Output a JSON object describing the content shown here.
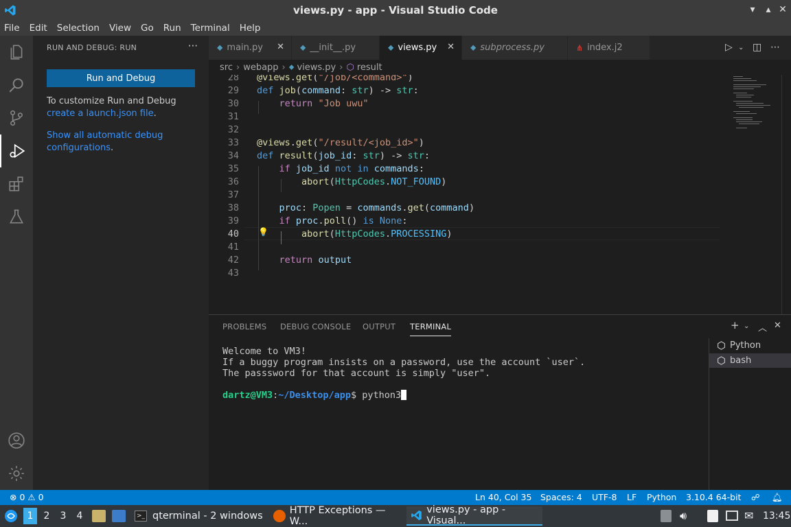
{
  "window": {
    "title": "views.py - app - Visual Studio Code"
  },
  "menu": [
    "File",
    "Edit",
    "Selection",
    "View",
    "Go",
    "Run",
    "Terminal",
    "Help"
  ],
  "sidebar": {
    "header": "RUN AND DEBUG: RUN",
    "run_button": "Run and Debug",
    "info_text": "To customize Run and Debug",
    "link_launch": "create a launch.json file",
    "link_launch_suffix": ".",
    "link_show_1": "Show all automatic debug",
    "link_show_2": "configurations",
    "link_show_suffix": "."
  },
  "tabs": [
    {
      "label": "main.py",
      "active": false,
      "italic": false
    },
    {
      "label": "__init__.py",
      "active": false,
      "italic": false
    },
    {
      "label": "views.py",
      "active": true,
      "italic": false
    },
    {
      "label": "subprocess.py",
      "active": false,
      "italic": true
    },
    {
      "label": "index.j2",
      "active": false,
      "italic": false
    }
  ],
  "breadcrumb": {
    "part1": "src",
    "part2": "webapp",
    "part3": "views.py",
    "part4": "result"
  },
  "editor": {
    "line_numbers": [
      "28",
      "29",
      "30",
      "31",
      "32",
      "33",
      "34",
      "35",
      "36",
      "37",
      "38",
      "39",
      "40",
      "41",
      "42",
      "43"
    ],
    "current_line": "40"
  },
  "panel": {
    "tabs": [
      "PROBLEMS",
      "DEBUG CONSOLE",
      "OUTPUT",
      "TERMINAL"
    ],
    "active_tab": "TERMINAL",
    "terminal": {
      "line1": "Welcome to VM3!",
      "line2": "If a buggy program insists on a password, use the account `user`.",
      "line3": "The passsword for that account is simply \"user\".",
      "prompt_user": "dartz@VM3",
      "prompt_colon": ":",
      "prompt_path": "~/Desktop/app",
      "prompt_dollar": "$ ",
      "command": "python3"
    },
    "terminals": [
      "Python",
      "bash"
    ]
  },
  "statusbar": {
    "errors": "0",
    "warnings": "0",
    "position": "Ln 40, Col 35",
    "spaces": "Spaces: 4",
    "encoding": "UTF-8",
    "eol": "LF",
    "language": "Python",
    "interpreter": "3.10.4 64-bit"
  },
  "taskbar": {
    "workspaces": [
      "1",
      "2",
      "3",
      "4"
    ],
    "tasks": [
      "qterminal - 2 windows",
      "HTTP Exceptions — W...",
      "views.py - app - Visual..."
    ],
    "clock": "13:45"
  },
  "colors": {
    "accent": "#007acc",
    "button": "#0e639c",
    "link": "#3794ff"
  }
}
